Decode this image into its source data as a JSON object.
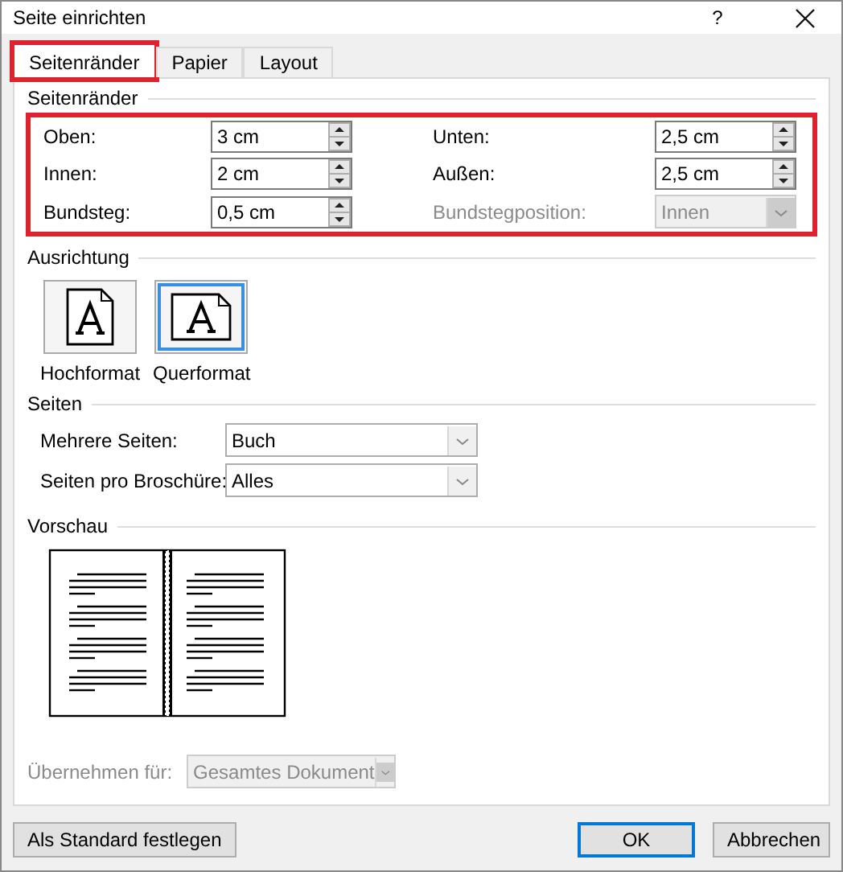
{
  "window": {
    "title": "Seite einrichten",
    "help": "?"
  },
  "tabs": [
    {
      "label": "Seitenränder",
      "selected": true,
      "highlighted": true
    },
    {
      "label": "Papier",
      "selected": false,
      "highlighted": false
    },
    {
      "label": "Layout",
      "selected": false,
      "highlighted": false
    }
  ],
  "margins": {
    "title": "Seitenränder",
    "highlighted": true,
    "fields": [
      {
        "label": "Oben:",
        "value": "3 cm",
        "kind": "spin",
        "disabled": false
      },
      {
        "label": "Unten:",
        "value": "2,5 cm",
        "kind": "spin",
        "disabled": false
      },
      {
        "label": "Innen:",
        "value": "2 cm",
        "kind": "spin",
        "disabled": false
      },
      {
        "label": "Außen:",
        "value": "2,5 cm",
        "kind": "spin",
        "disabled": false
      },
      {
        "label": "Bundsteg:",
        "value": "0,5 cm",
        "kind": "spin",
        "disabled": false
      },
      {
        "label": "Bundstegposition:",
        "value": "Innen",
        "kind": "combo",
        "disabled": true
      }
    ]
  },
  "orientation": {
    "title": "Ausrichtung",
    "options": [
      {
        "label": "Hochformat",
        "kind": "portrait",
        "selected": false
      },
      {
        "label": "Querformat",
        "kind": "landscape",
        "selected": true
      }
    ]
  },
  "pages": {
    "title": "Seiten",
    "fields": [
      {
        "label": "Mehrere Seiten:",
        "value": "Buch"
      },
      {
        "label": "Seiten pro Broschüre:",
        "value": "Alles"
      }
    ]
  },
  "preview": {
    "title": "Vorschau"
  },
  "apply": {
    "label": "Übernehmen für:",
    "value": "Gesamtes Dokument",
    "disabled": true
  },
  "buttons": [
    {
      "label": "Als Standard festlegen",
      "default": false
    },
    {
      "label": "OK",
      "default": true
    },
    {
      "label": "Abbrechen",
      "default": false
    }
  ]
}
